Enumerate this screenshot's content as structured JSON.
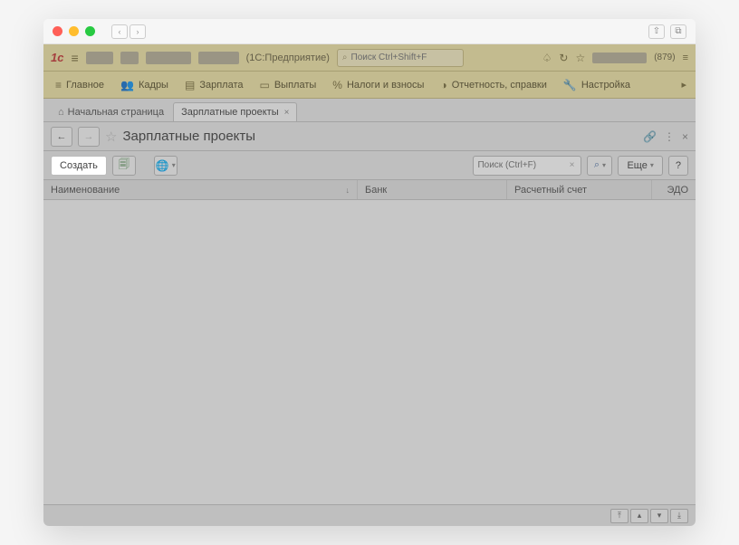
{
  "app": {
    "subtitle": "(1С:Предприятие)",
    "global_search_placeholder": "Поиск Ctrl+Shift+F",
    "user_count": "(879)"
  },
  "menu": {
    "main": "Главное",
    "staff": "Кадры",
    "salary": "Зарплата",
    "payments": "Выплаты",
    "taxes": "Налоги и взносы",
    "reports": "Отчетность, справки",
    "settings": "Настройка"
  },
  "tabs": {
    "home": "Начальная страница",
    "active": "Зарплатные проекты"
  },
  "page": {
    "title": "Зарплатные проекты"
  },
  "toolbar": {
    "create": "Создать",
    "search_placeholder": "Поиск (Ctrl+F)",
    "more": "Еще",
    "help": "?"
  },
  "columns": {
    "name": "Наименование",
    "bank": "Банк",
    "account": "Расчетный счет",
    "edo": "ЭДО"
  }
}
